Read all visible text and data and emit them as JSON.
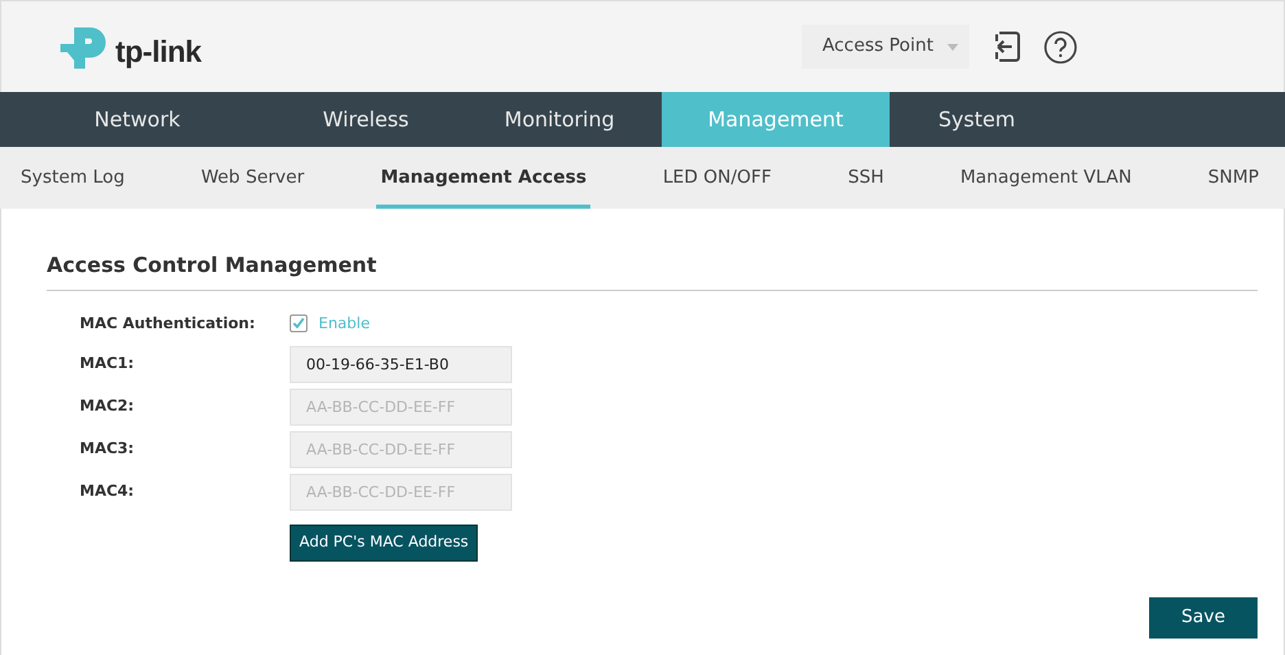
{
  "header": {
    "logo_text": "tp-link",
    "mode_select": {
      "value": "Access Point"
    }
  },
  "main_tabs": [
    {
      "label": "Network",
      "selected": false
    },
    {
      "label": "Wireless",
      "selected": false
    },
    {
      "label": "Monitoring",
      "selected": false
    },
    {
      "label": "Management",
      "selected": true
    },
    {
      "label": "System",
      "selected": false
    }
  ],
  "sub_tabs": [
    {
      "label": "System Log",
      "selected": false
    },
    {
      "label": "Web Server",
      "selected": false
    },
    {
      "label": "Management Access",
      "selected": true
    },
    {
      "label": "LED ON/OFF",
      "selected": false
    },
    {
      "label": "SSH",
      "selected": false
    },
    {
      "label": "Management VLAN",
      "selected": false
    },
    {
      "label": "SNMP",
      "selected": false
    }
  ],
  "section": {
    "title": "Access Control Management",
    "mac_authentication": {
      "label": "MAC Authentication:",
      "option": "Enable",
      "checked": true
    },
    "mac_fields": [
      {
        "label": "MAC1:",
        "value": "00-19-66-35-E1-B0"
      },
      {
        "label": "MAC2:",
        "placeholder": "AA-BB-CC-DD-EE-FF"
      },
      {
        "label": "MAC3:",
        "placeholder": "AA-BB-CC-DD-EE-FF"
      },
      {
        "label": "MAC4:",
        "placeholder": "AA-BB-CC-DD-EE-FF"
      }
    ],
    "add_button": "Add PC's MAC Address"
  },
  "save_button": "Save"
}
